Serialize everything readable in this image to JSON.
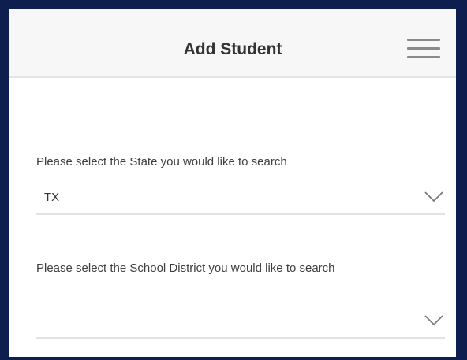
{
  "header": {
    "title": "Add Student"
  },
  "state_field": {
    "label": "Please select the State you would like to search",
    "value": "TX"
  },
  "district_field": {
    "label": "Please select the School District you would like to search",
    "value": ""
  },
  "icons": {
    "menu": "hamburger-menu-icon",
    "dropdown": "chevron-down-icon"
  },
  "colors": {
    "outer_border": "#0e1f4f",
    "header_bg": "#f7f7f7",
    "divider": "#e3e3e3",
    "text": "#333333"
  }
}
